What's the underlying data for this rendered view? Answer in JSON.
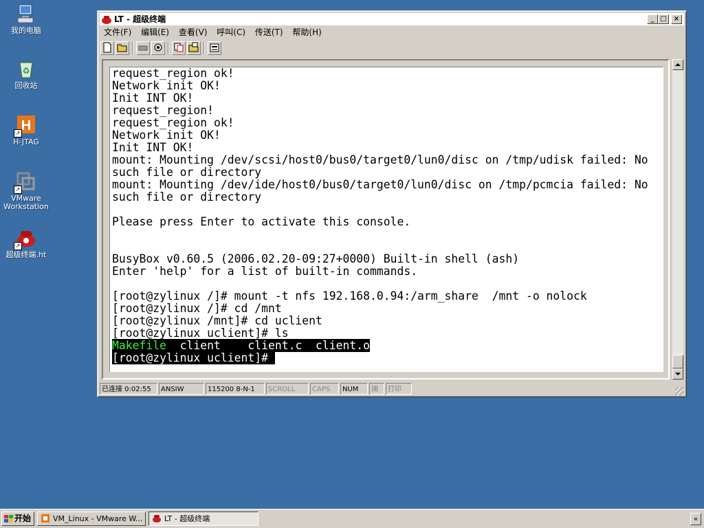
{
  "desktop": {
    "icons": [
      {
        "label": "我的电脑",
        "icon": "my-computer-icon"
      },
      {
        "label": "回收站",
        "icon": "recycle-bin-icon"
      },
      {
        "label": "H-JTAG",
        "icon": "hjtag-icon"
      },
      {
        "label1": "VMware",
        "label2": "Workstation",
        "icon": "vmware-icon"
      },
      {
        "label": "超级终端.ht",
        "icon": "hyperterminal-icon"
      }
    ]
  },
  "window": {
    "title": "LT - 超级终端",
    "buttons": {
      "minimize": "_",
      "maximize": "□",
      "close": "×"
    },
    "menu": [
      "文件(F)",
      "编辑(E)",
      "查看(V)",
      "呼叫(C)",
      "传送(T)",
      "帮助(H)"
    ],
    "toolbar": [
      "new-icon",
      "open-icon",
      "disconnect-icon",
      "dial-icon",
      "send-icon",
      "receive-icon",
      "properties-icon"
    ]
  },
  "terminal": {
    "lines": [
      "request_region ok!",
      "Network init OK!",
      "Init INT OK!",
      "request_region!",
      "request_region ok!",
      "Network init OK!",
      "Init INT OK!",
      "mount: Mounting /dev/scsi/host0/bus0/target0/lun0/disc on /tmp/udisk failed: No",
      "such file or directory",
      "mount: Mounting /dev/ide/host0/bus0/target0/lun0/disc on /tmp/pcmcia failed: No",
      "such file or directory",
      "",
      "Please press Enter to activate this console.",
      "",
      "",
      "BusyBox v0.60.5 (2006.02.20-09:27+0000) Built-in shell (ash)",
      "Enter 'help' for a list of built-in commands.",
      "",
      "[root@zylinux /]# mount -t nfs 192.168.0.94:/arm_share  /mnt -o nolock",
      "[root@zylinux /]# cd /mnt",
      "[root@zylinux /mnt]# cd uclient",
      "[root@zylinux uclient]# ls"
    ],
    "ls_output": {
      "green": "Makefile",
      "rest": "  client    client.c  client.o"
    },
    "prompt": "[root@zylinux uclient]# "
  },
  "status": {
    "connected": "已连接 0:02:55",
    "emulation": "ANSIW",
    "settings": "115200 8-N-1",
    "scroll": "SCROLL",
    "caps": "CAPS",
    "num": "NUM",
    "capture": "捕",
    "print": "打印"
  },
  "taskbar": {
    "start": "开始",
    "tasks": [
      "VM_Linux - VMware W...",
      "LT - 超级终端"
    ]
  },
  "colors": {
    "desktop": "#3a6ea5",
    "ls_green": "#3cf03c"
  }
}
